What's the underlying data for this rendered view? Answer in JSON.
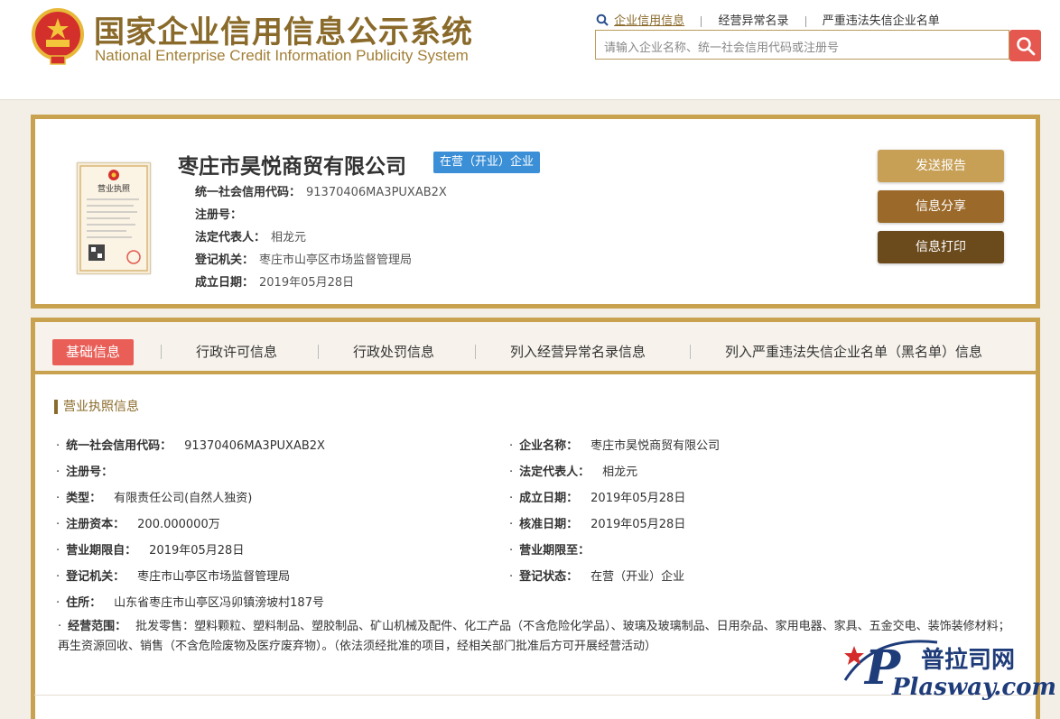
{
  "header": {
    "title_cn": "国家企业信用信息公示系统",
    "title_en": "National Enterprise Credit Information Publicity System",
    "nav": [
      "企业信用信息",
      "经营异常名录",
      "严重违法失信企业名单"
    ],
    "search_placeholder": "请输入企业名称、统一社会信用代码或注册号"
  },
  "company": {
    "name": "枣庄市昊悦商贸有限公司",
    "status": "在营（开业）企业",
    "fields": [
      {
        "label": "统一社会信用代码：",
        "value": "91370406MA3PUXAB2X"
      },
      {
        "label": "注册号：",
        "value": ""
      },
      {
        "label": "法定代表人：",
        "value": "相龙元"
      },
      {
        "label": "登记机关：",
        "value": "枣庄市山亭区市场监督管理局"
      },
      {
        "label": "成立日期：",
        "value": "2019年05月28日"
      }
    ],
    "license_title": "营业执照"
  },
  "actions": {
    "send_report": "发送报告",
    "share": "信息分享",
    "print": "信息打印"
  },
  "tabs": [
    "基础信息",
    "行政许可信息",
    "行政处罚信息",
    "列入经营异常名录信息",
    "列入严重违法失信企业名单（黑名单）信息"
  ],
  "section_title": "营业执照信息",
  "details_left": [
    {
      "label": "统一社会信用代码：",
      "value": "91370406MA3PUXAB2X"
    },
    {
      "label": "注册号：",
      "value": ""
    },
    {
      "label": "类型：",
      "value": "有限责任公司(自然人独资)"
    },
    {
      "label": "注册资本：",
      "value": "200.000000万"
    },
    {
      "label": "营业期限自：",
      "value": "2019年05月28日"
    },
    {
      "label": "登记机关：",
      "value": "枣庄市山亭区市场监督管理局"
    },
    {
      "label": "住所：",
      "value": "山东省枣庄市山亭区冯卯镇滂坡村187号"
    }
  ],
  "details_right": [
    {
      "label": "企业名称：",
      "value": "枣庄市昊悦商贸有限公司"
    },
    {
      "label": "法定代表人：",
      "value": "相龙元"
    },
    {
      "label": "成立日期：",
      "value": "2019年05月28日"
    },
    {
      "label": "核准日期：",
      "value": "2019年05月28日"
    },
    {
      "label": "营业期限至：",
      "value": ""
    },
    {
      "label": "登记状态：",
      "value": "在营（开业）企业"
    }
  ],
  "scope": {
    "label": "经营范围：",
    "value": "批发零售：塑料颗粒、塑料制品、塑胶制品、矿山机械及配件、化工产品（不含危险化学品）、玻璃及玻璃制品、日用杂品、家用电器、家具、五金交电、装饰装修材料；再生资源回收、销售（不含危险废物及医疗废弃物）。（依法须经批准的项目，经相关部门批准后方可开展经营活动）"
  },
  "watermark": {
    "cn": "普拉司网",
    "en": "Plasway.com"
  },
  "colors": {
    "gold": "#c9a24f",
    "brown": "#8a6a2a",
    "red": "#e4584f",
    "blue": "#3a8fd6"
  }
}
